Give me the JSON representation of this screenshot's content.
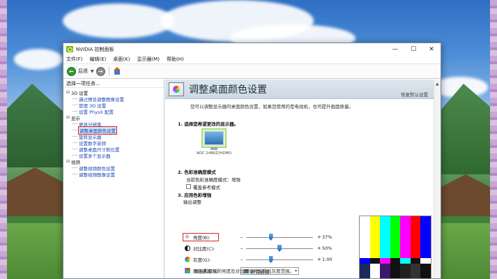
{
  "window": {
    "title": "NVIDIA 控制面板",
    "controls": [
      "—",
      "☐",
      "✕"
    ]
  },
  "menubar": [
    "文件(F)",
    "编辑(E)",
    "桌面(K)",
    "显示器(M)",
    "帮助(H)"
  ],
  "toolbar": {
    "back_label": "后退"
  },
  "leftpane": {
    "task_head": "选择一项任务...",
    "tree": [
      {
        "label": "3D 设置",
        "level": 0
      },
      {
        "label": "通过预览调整图像设置",
        "level": 1
      },
      {
        "label": "管理 3D 设置",
        "level": 1
      },
      {
        "label": "设置 PhysX 配置",
        "level": 1
      },
      {
        "label": "显示",
        "level": 0
      },
      {
        "label": "更改分辨率",
        "level": 1
      },
      {
        "label": "调整桌面颜色设置",
        "level": 1,
        "selected": true
      },
      {
        "label": "旋转显示器",
        "level": 1
      },
      {
        "label": "设置数字音频",
        "level": 1
      },
      {
        "label": "调整桌面尺寸和位置",
        "level": 1
      },
      {
        "label": "设置多个显示器",
        "level": 1
      },
      {
        "label": "视频",
        "level": 0
      },
      {
        "label": "调整视频颜色设置",
        "level": 1
      },
      {
        "label": "调整视频图像设置",
        "level": 1
      }
    ]
  },
  "main": {
    "title": "调整桌面颜色设置",
    "restore": "恢复默认设置",
    "description": "您可以调整显示器的桌面颜色设置，如果您使用的是电视机，也可提升画面质量。",
    "step1": "1.  选择您希望更改的显示器。",
    "monitor_label": "AOC 2480Z(HDMI)",
    "step2": "2.  色彩准确度模式",
    "current_mode": "当前色彩准确度模式：增强",
    "override_label": "覆盖参考模式",
    "step3": "3.  应用色彩增强",
    "output_adjust": "输出调整",
    "channel_label": "颜色通道(N):",
    "channel_value": "所有通道",
    "brightness_label": "亮度(B):",
    "brightness_value": "37%",
    "brightness_level": 37,
    "contrast_label": "对比度(C):",
    "contrast_value": "50%",
    "contrast_level": 50,
    "gamma_label": "灰度(G):",
    "gamma_value": "1.00",
    "gamma_level": 37,
    "note": "极高和极低的亮度及对比度值可能降低灰度范围。"
  },
  "colors": {
    "nvidia_green": "#76b900",
    "highlight_red": "#e02020",
    "banner_bg": "#dfe7ef"
  }
}
